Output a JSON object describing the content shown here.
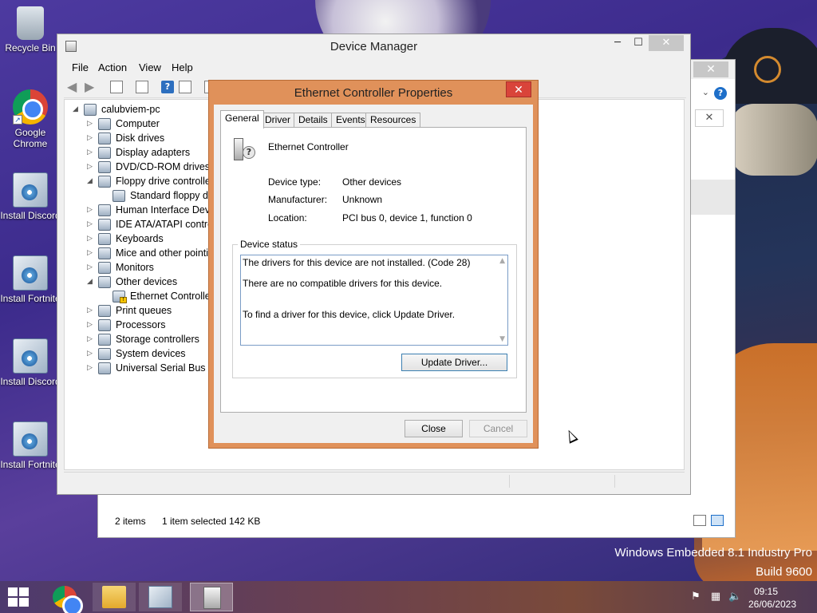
{
  "desktop": {
    "icons": [
      {
        "label": "Recycle Bin",
        "icon": "recycle-bin-icon"
      },
      {
        "label": "Google Chrome",
        "icon": "chrome-icon"
      },
      {
        "label": "Install Discord",
        "icon": "installer-icon"
      },
      {
        "label": "Install Fortnite",
        "icon": "installer-icon"
      },
      {
        "label": "Install Discord",
        "icon": "installer-icon"
      },
      {
        "label": "Install Fortnite",
        "icon": "installer-icon"
      }
    ],
    "watermark": {
      "line1": "Windows Embedded 8.1 Industry Pro",
      "line2": "Build 9600"
    }
  },
  "explorer_back": {
    "status_items": "2 items",
    "status_selected": "1 item selected  142 KB",
    "help_glyph": "?",
    "close_glyph": "✕",
    "search_clear_glyph": "✕"
  },
  "device_manager": {
    "title": "Device Manager",
    "caption": {
      "minimize": "─",
      "maximize": "☐",
      "close": "✕"
    },
    "menu": [
      "File",
      "Action",
      "View",
      "Help"
    ],
    "toolbar_help_glyph": "?",
    "tree": [
      {
        "label": "calubviem-pc",
        "level": 0,
        "expander": "◢"
      },
      {
        "label": "Computer",
        "level": 1,
        "expander": "▷"
      },
      {
        "label": "Disk drives",
        "level": 1,
        "expander": "▷"
      },
      {
        "label": "Display adapters",
        "level": 1,
        "expander": "▷"
      },
      {
        "label": "DVD/CD-ROM drives",
        "level": 1,
        "expander": "▷"
      },
      {
        "label": "Floppy drive controllers",
        "level": 1,
        "expander": "◢"
      },
      {
        "label": "Standard floppy disk controller",
        "level": 2,
        "expander": ""
      },
      {
        "label": "Human Interface Devices",
        "level": 1,
        "expander": "▷"
      },
      {
        "label": "IDE ATA/ATAPI controllers",
        "level": 1,
        "expander": "▷"
      },
      {
        "label": "Keyboards",
        "level": 1,
        "expander": "▷"
      },
      {
        "label": "Mice and other pointing devices",
        "level": 1,
        "expander": "▷"
      },
      {
        "label": "Monitors",
        "level": 1,
        "expander": "▷"
      },
      {
        "label": "Other devices",
        "level": 1,
        "expander": "◢"
      },
      {
        "label": "Ethernet Controller",
        "level": 2,
        "expander": "",
        "warning": true
      },
      {
        "label": "Print queues",
        "level": 1,
        "expander": "▷"
      },
      {
        "label": "Processors",
        "level": 1,
        "expander": "▷"
      },
      {
        "label": "Storage controllers",
        "level": 1,
        "expander": "▷"
      },
      {
        "label": "System devices",
        "level": 1,
        "expander": "▷"
      },
      {
        "label": "Universal Serial Bus controllers",
        "level": 1,
        "expander": "▷"
      }
    ]
  },
  "properties_dialog": {
    "title": "Ethernet Controller Properties",
    "close_glyph": "✕",
    "tabs": [
      "General",
      "Driver",
      "Details",
      "Events",
      "Resources"
    ],
    "active_tab": "General",
    "device_name": "Ethernet Controller",
    "device_type_label": "Device type:",
    "device_type_value": "Other devices",
    "manufacturer_label": "Manufacturer:",
    "manufacturer_value": "Unknown",
    "location_label": "Location:",
    "location_value": "PCI bus 0, device 1, function 0",
    "status_group_label": "Device status",
    "status_lines": [
      "The drivers for this device are not installed. (Code 28)",
      "There are no compatible drivers for this device.",
      "To find a driver for this device, click Update Driver."
    ],
    "update_driver_label": "Update Driver...",
    "close_label": "Close",
    "cancel_label": "Cancel"
  },
  "taskbar": {
    "time": "09:15",
    "date": "26/06/2023",
    "tasks": [
      "chrome-icon",
      "file-explorer-icon",
      "installer-icon",
      "device-manager-icon"
    ],
    "active_task": "device-manager-icon",
    "tray": {
      "flag": "⚑",
      "network": "▦",
      "volume": "🔈"
    }
  },
  "colors": {
    "dialog_frame": "#e0915a",
    "dialog_close": "#d9443a",
    "taskbar": "#6a4050",
    "accent_blue": "#1e6fc9"
  }
}
